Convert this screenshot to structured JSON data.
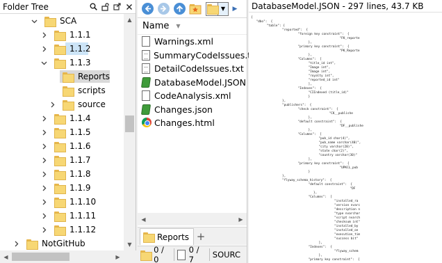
{
  "tree": {
    "title": "Folder Tree",
    "header_icons": [
      "search-icon",
      "unlock-icon",
      "popout-icon",
      "close-icon"
    ],
    "items": [
      {
        "label": "SCA",
        "chevron": "down",
        "level": 0,
        "state": ""
      },
      {
        "label": "1.1.1",
        "chevron": "right",
        "level": 1,
        "state": ""
      },
      {
        "label": "1.1.2",
        "chevron": "right",
        "level": 1,
        "state": "selected"
      },
      {
        "label": "1.1.3",
        "chevron": "down",
        "level": 1,
        "state": ""
      },
      {
        "label": "Reports",
        "chevron": "",
        "level": 2,
        "state": "current"
      },
      {
        "label": "scripts",
        "chevron": "",
        "level": 2,
        "state": ""
      },
      {
        "label": "source",
        "chevron": "right",
        "level": 2,
        "state": ""
      },
      {
        "label": "1.1.4",
        "chevron": "right",
        "level": 1,
        "state": ""
      },
      {
        "label": "1.1.5",
        "chevron": "right",
        "level": 1,
        "state": ""
      },
      {
        "label": "1.1.6",
        "chevron": "right",
        "level": 1,
        "state": ""
      },
      {
        "label": "1.1.7",
        "chevron": "right",
        "level": 1,
        "state": ""
      },
      {
        "label": "1.1.8",
        "chevron": "right",
        "level": 1,
        "state": ""
      },
      {
        "label": "1.1.9",
        "chevron": "right",
        "level": 1,
        "state": ""
      },
      {
        "label": "1.1.10",
        "chevron": "right",
        "level": 1,
        "state": ""
      },
      {
        "label": "1.1.11",
        "chevron": "right",
        "level": 1,
        "state": ""
      },
      {
        "label": "1.1.12",
        "chevron": "right",
        "level": 1,
        "state": ""
      },
      {
        "label": "NotGitHub",
        "chevron": "right",
        "level": -1,
        "state": ""
      }
    ]
  },
  "toolbar": {
    "back_icon": "back-arrow-icon",
    "forward_icon": "forward-arrow-icon",
    "up_icon": "up-arrow-icon",
    "favorites_icon": "favorites-folder-icon",
    "folder_icon": "folder-icon",
    "colors": {
      "back": "#4a8fd6",
      "forward": "#a8c8e8",
      "up": "#4a8fd6",
      "fav": "#f4a340"
    }
  },
  "file_list": {
    "column_name": "Name",
    "files": [
      {
        "name": "Warnings.xml",
        "icon": "document-icon"
      },
      {
        "name": "SummaryCodeIssues.txt",
        "icon": "text-document-icon"
      },
      {
        "name": "DetailCodeIssues.txt",
        "icon": "text-document-icon"
      },
      {
        "name": "DatabaseModel.JSON",
        "icon": "green-json-icon"
      },
      {
        "name": "CodeAnalysis.xml",
        "icon": "document-icon"
      },
      {
        "name": "Changes.json",
        "icon": "green-json-icon"
      },
      {
        "name": "Changes.html",
        "icon": "chrome-icon"
      }
    ]
  },
  "tabs": [
    {
      "label": "Reports",
      "add_label": "+"
    }
  ],
  "status": {
    "folders": "0 / 0",
    "files": "0 / 7",
    "path": "SOURC"
  },
  "preview": {
    "title": "DatabaseModel.JSON - 297 lines, 43.7 KB",
    "lines": [
      {
        "t": "{",
        "i": 0
      },
      {
        "t": "\"dbo\":  {",
        "i": 1
      },
      {
        "t": "\"table\": {",
        "i": 3
      },
      {
        "t": "\"reported\":  {",
        "i": 6
      },
      {
        "t": "\"foreign key constraint\":  {",
        "i": 9
      },
      {
        "t": "\"FK_reporte",
        "i": 17
      },
      {
        "t": "},",
        "i": 11
      },
      {
        "t": "\"primary key constraint\":  {",
        "i": 9
      },
      {
        "t": "\"PK_Reporte",
        "i": 17
      },
      {
        "t": "},",
        "i": 11
      },
      {
        "t": "\"Columns\":  [",
        "i": 9
      },
      {
        "t": "\"title_id int\",",
        "i": 11
      },
      {
        "t": "\"Image int\",",
        "i": 11
      },
      {
        "t": "\"Image int\",",
        "i": 11
      },
      {
        "t": "\"royalty int\",",
        "i": 11
      },
      {
        "t": "\"reported_id int\"",
        "i": 11
      },
      {
        "t": "],",
        "i": 11
      },
      {
        "t": "\"Indexes\":  {",
        "i": 9
      },
      {
        "t": "\"CIIndexed (title_id)\"",
        "i": 11
      },
      {
        "t": "}",
        "i": 11
      },
      {
        "t": "},",
        "i": 6
      },
      {
        "t": "\"publishers\":  {",
        "i": 6
      },
      {
        "t": "\"check constraint\":  {",
        "i": 9
      },
      {
        "t": "\"CK__publishe",
        "i": 15
      },
      {
        "t": "},",
        "i": 11
      },
      {
        "t": "\"default constraint\":  {",
        "i": 9
      },
      {
        "t": "\"DF__publishe",
        "i": 17
      },
      {
        "t": "},",
        "i": 11
      },
      {
        "t": "\"Columns\":  [",
        "i": 9
      },
      {
        "t": "\"pub_id char(4)\",",
        "i": 13
      },
      {
        "t": "\"pub_name varchar(40)\",",
        "i": 13
      },
      {
        "t": "\"city varchar(20)\",",
        "i": 13
      },
      {
        "t": "\"state char(2)\",",
        "i": 13
      },
      {
        "t": "\"country varchar(30)\"",
        "i": 13
      },
      {
        "t": "],",
        "i": 11
      },
      {
        "t": "\"primary key constraint\":  {",
        "i": 9
      },
      {
        "t": "\"UPKCL_pub",
        "i": 17
      },
      {
        "t": "}",
        "i": 11
      },
      {
        "t": "},",
        "i": 6
      },
      {
        "t": "\"flyway_schema_history\":  {",
        "i": 6
      },
      {
        "t": "\"default constraint\":  {",
        "i": 11
      },
      {
        "t": "\"DF",
        "i": 19
      },
      {
        "t": "},",
        "i": 12
      },
      {
        "t": "\"Columns\":  [",
        "i": 11
      },
      {
        "t": "\"installed_ra",
        "i": 16
      },
      {
        "t": "\"version nvarc",
        "i": 16
      },
      {
        "t": "\"description n",
        "i": 16
      },
      {
        "t": "\"type nvarchar",
        "i": 16
      },
      {
        "t": "\"script nvarch",
        "i": 16
      },
      {
        "t": "\"checksum int\"",
        "i": 16
      },
      {
        "t": "\"installed_by",
        "i": 16
      },
      {
        "t": "\"installed_on",
        "i": 16
      },
      {
        "t": "\"execution_tim",
        "i": 16
      },
      {
        "t": "\"success bit\"",
        "i": 16
      },
      {
        "t": "],",
        "i": 13
      },
      {
        "t": "\"Indexes\":  {",
        "i": 11
      },
      {
        "t": "\"flyway_schem",
        "i": 16
      },
      {
        "t": "},",
        "i": 13
      },
      {
        "t": "\"primary key constraint\":  {",
        "i": 11
      }
    ]
  }
}
